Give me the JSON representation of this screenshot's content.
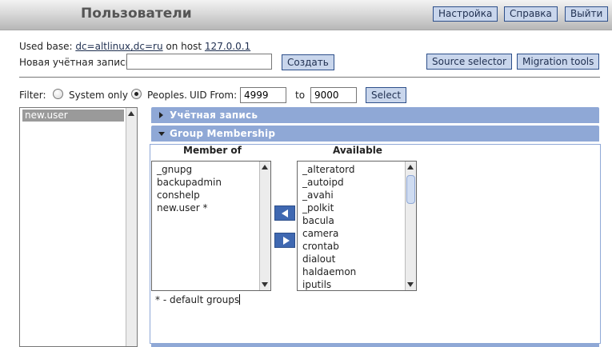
{
  "header": {
    "title": "Пользователи",
    "buttons": {
      "settings": "Настройка",
      "help": "Справка",
      "logout": "Выйти"
    }
  },
  "info": {
    "used_base_label": "Used base:",
    "base_dn": "dc=altlinux,dc=ru",
    "on_host_label": "on host",
    "host": "127.0.0.1"
  },
  "new_account": {
    "label": "Новая учётная запись:",
    "value": "",
    "create_label": "Создать"
  },
  "tools": {
    "source_selector": "Source selector",
    "migration_tools": "Migration tools"
  },
  "filter": {
    "label": "Filter:",
    "system_only": "System only",
    "peoples": "Peoples.",
    "selected": "peoples",
    "uid_from_label": "UID From:",
    "uid_from": "4999",
    "to_label": "to",
    "uid_to": "9000",
    "select_label": "Select"
  },
  "users": [
    "new.user"
  ],
  "sections": {
    "account": "Учётная запись",
    "group_membership": "Group Membership"
  },
  "membership": {
    "member_of_header": "Member of",
    "available_header": "Available",
    "member_of": [
      "_gnupg",
      "backupadmin",
      "conshelp",
      "new.user *"
    ],
    "available": [
      "_alteratord",
      "_autoipd",
      "_avahi",
      "_polkit",
      "bacula",
      "camera",
      "crontab",
      "dialout",
      "haldaemon",
      "iputils"
    ],
    "note": "* - default groups"
  },
  "colors": {
    "accent": "#8fa8d6",
    "button_bg": "#c9d6ec",
    "move_button": "#3f68b1"
  },
  "icons": {
    "add": "arrow-left-icon",
    "remove": "arrow-right-icon"
  }
}
